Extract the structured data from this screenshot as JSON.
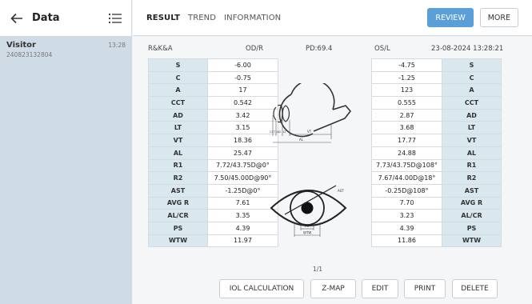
{
  "sidebar": {
    "title": "Data",
    "item": {
      "name": "Visitor",
      "time": "13:28",
      "id": "240823132804"
    }
  },
  "tabs": [
    {
      "label": "RESULT",
      "active": true
    },
    {
      "label": "TREND",
      "active": false
    },
    {
      "label": "INFORMATION",
      "active": false
    }
  ],
  "buttons": {
    "review": "REVIEW",
    "more": "MORE"
  },
  "info": {
    "mode": "R&K&A",
    "od": "OD/R",
    "pd": "PD:69.4",
    "os": "OS/L",
    "datetime": "23-08-2024 13:28:21"
  },
  "measurements": {
    "od": [
      {
        "label": "S",
        "value": "-6.00"
      },
      {
        "label": "C",
        "value": "-0.75"
      },
      {
        "label": "A",
        "value": "17"
      },
      {
        "label": "CCT",
        "value": "0.542"
      },
      {
        "label": "AD",
        "value": "3.42"
      },
      {
        "label": "LT",
        "value": "3.15"
      },
      {
        "label": "VT",
        "value": "18.36"
      },
      {
        "label": "AL",
        "value": "25.47"
      },
      {
        "label": "R1",
        "value": "7.72/43.75D@0°"
      },
      {
        "label": "R2",
        "value": "7.50/45.00D@90°"
      },
      {
        "label": "AST",
        "value": "-1.25D@0°"
      },
      {
        "label": "AVG R",
        "value": "7.61"
      },
      {
        "label": "AL/CR",
        "value": "3.35"
      },
      {
        "label": "PS",
        "value": "4.39"
      },
      {
        "label": "WTW",
        "value": "11.97"
      }
    ],
    "os": [
      {
        "label": "S",
        "value": "-4.75"
      },
      {
        "label": "C",
        "value": "-1.25"
      },
      {
        "label": "A",
        "value": "123"
      },
      {
        "label": "CCT",
        "value": "0.555"
      },
      {
        "label": "AD",
        "value": "2.87"
      },
      {
        "label": "LT",
        "value": "3.68"
      },
      {
        "label": "VT",
        "value": "17.77"
      },
      {
        "label": "AL",
        "value": "24.88"
      },
      {
        "label": "R1",
        "value": "7.73/43.75D@108°"
      },
      {
        "label": "R2",
        "value": "7.67/44.00D@18°"
      },
      {
        "label": "AST",
        "value": "-0.25D@108°"
      },
      {
        "label": "AVG R",
        "value": "7.70"
      },
      {
        "label": "AL/CR",
        "value": "3.23"
      },
      {
        "label": "PS",
        "value": "4.39"
      },
      {
        "label": "WTW",
        "value": "11.86"
      }
    ]
  },
  "diagram": {
    "eye_side_labels": [
      "CCT",
      "AD",
      "LT",
      "VT",
      "AL"
    ],
    "eye_front_labels": [
      "AST",
      "PS",
      "WTW"
    ]
  },
  "page_indicator": "1/1",
  "actions": {
    "iol": "IOL CALCULATION",
    "zmap": "Z-MAP",
    "edit": "EDIT",
    "print": "PRINT",
    "delete": "DELETE"
  },
  "colors": {
    "accent": "#5a9fd8",
    "label_cell": "#d9e7ee",
    "sidebar_selected": "#cfdbe5"
  }
}
